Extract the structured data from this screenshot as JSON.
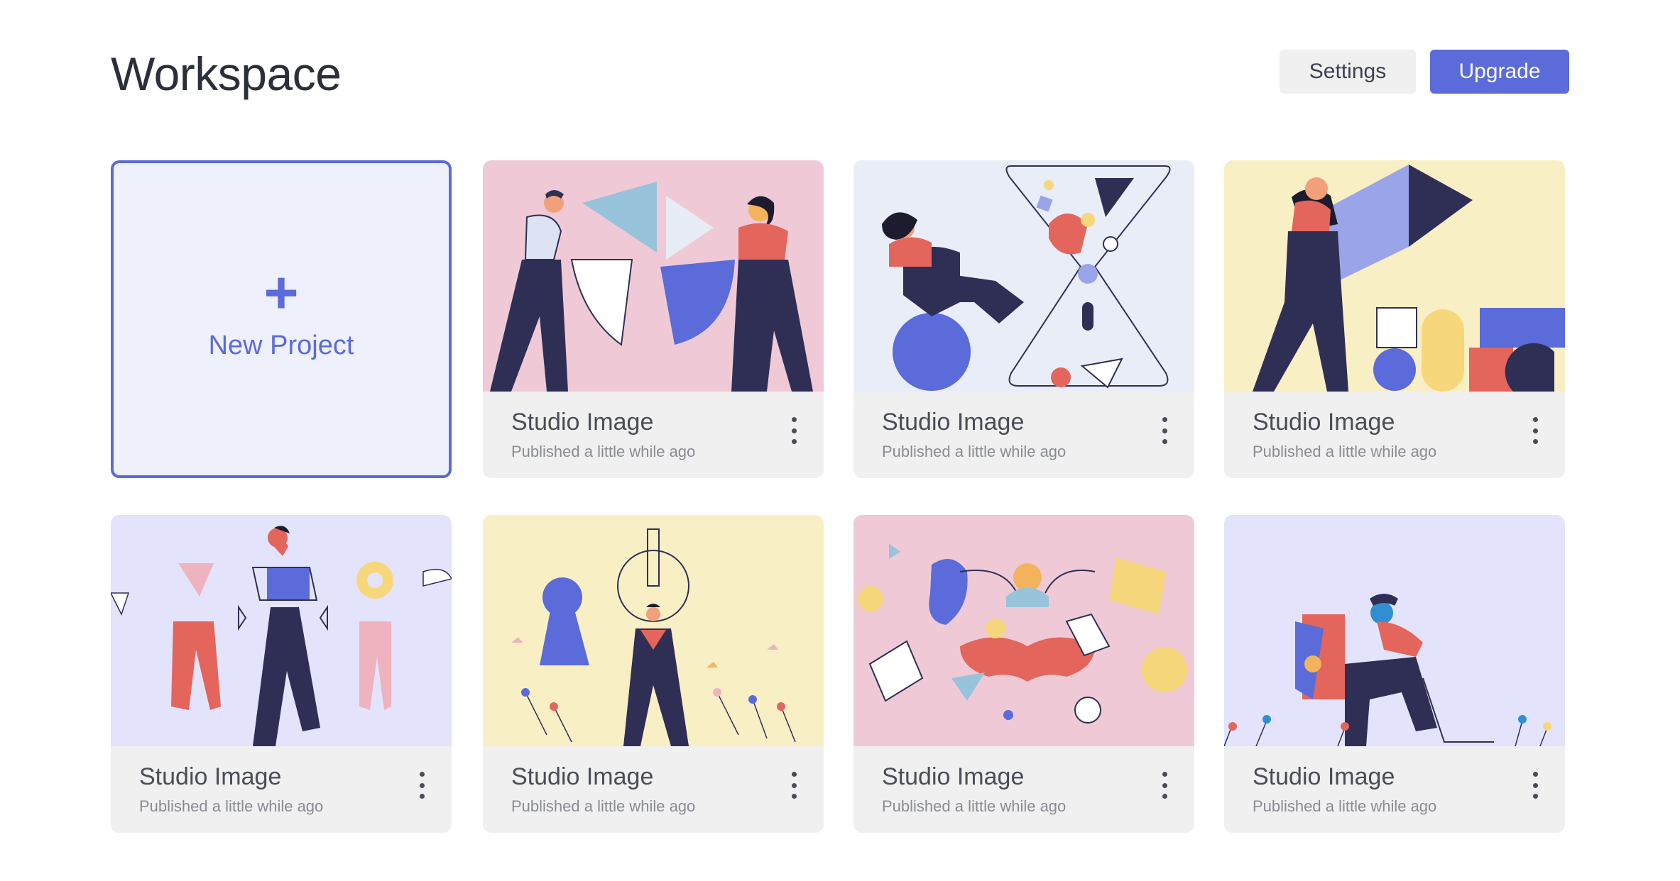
{
  "header": {
    "title": "Workspace",
    "settings_label": "Settings",
    "upgrade_label": "Upgrade"
  },
  "new_project": {
    "icon": "+",
    "label": "New Project"
  },
  "colors": {
    "accent": "#5b6bd9",
    "pink": "#efcad6",
    "light_blue": "#e8edf8",
    "cream": "#f9efc4",
    "lavender": "#e3e4fb",
    "navy": "#2f2f55",
    "coral": "#e3655b"
  },
  "cards": [
    {
      "title": "Studio Image",
      "subtitle": "Published a little while ago",
      "illustration": "two-people-pie-chart"
    },
    {
      "title": "Studio Image",
      "subtitle": "Published a little while ago",
      "illustration": "hourglass-woman"
    },
    {
      "title": "Studio Image",
      "subtitle": "Published a little while ago",
      "illustration": "woman-carrying-shapes"
    },
    {
      "title": "Studio Image",
      "subtitle": "Published a little while ago",
      "illustration": "mannequin-box-man"
    },
    {
      "title": "Studio Image",
      "subtitle": "Published a little while ago",
      "illustration": "keyhole-key-person"
    },
    {
      "title": "Studio Image",
      "subtitle": "Published a little while ago",
      "illustration": "floating-shapes-meditation"
    },
    {
      "title": "Studio Image",
      "subtitle": "Published a little while ago",
      "illustration": "man-with-mirror"
    }
  ]
}
